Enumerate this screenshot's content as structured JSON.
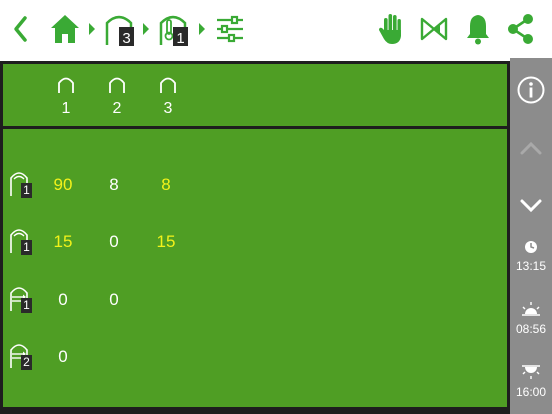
{
  "toolbar": {
    "back_icon": "chevron-left-icon",
    "home_icon": "home-icon",
    "house_badge": "3",
    "house_sensor_badge": "1",
    "settings_icon": "sliders-icon",
    "hand_icon": "hand-icon",
    "valve_icon": "valve-icon",
    "bell_icon": "bell-icon",
    "share_icon": "share-icon",
    "icon_color": "#3aaa35"
  },
  "table": {
    "columns": [
      "1",
      "2",
      "3"
    ],
    "rows": [
      {
        "icon": "house-heat-icon",
        "badge": "1",
        "values": [
          "90",
          "8",
          "8"
        ],
        "highlight": [
          true,
          false,
          true
        ]
      },
      {
        "icon": "house-heat-icon",
        "badge": "1",
        "values": [
          "15",
          "0",
          "15"
        ],
        "highlight": [
          true,
          false,
          true
        ]
      },
      {
        "icon": "house-inlet-icon",
        "badge": "1",
        "values": [
          "0",
          "0",
          ""
        ],
        "highlight": [
          false,
          false,
          false
        ]
      },
      {
        "icon": "house-inlet-icon",
        "badge": "2",
        "values": [
          "0",
          "",
          ""
        ],
        "highlight": [
          false,
          false,
          false
        ]
      }
    ],
    "colors": {
      "background": "#4f9e24",
      "value": "#ffffff",
      "highlight": "#f2f21a"
    }
  },
  "sidebar": {
    "info_icon": "info-icon",
    "up_icon": "chevron-up-icon",
    "down_icon": "chevron-down-icon",
    "clock_time": "13:15",
    "sunrise_time": "08:56",
    "sunset_time": "16:00",
    "background": "#8c8c8c"
  }
}
